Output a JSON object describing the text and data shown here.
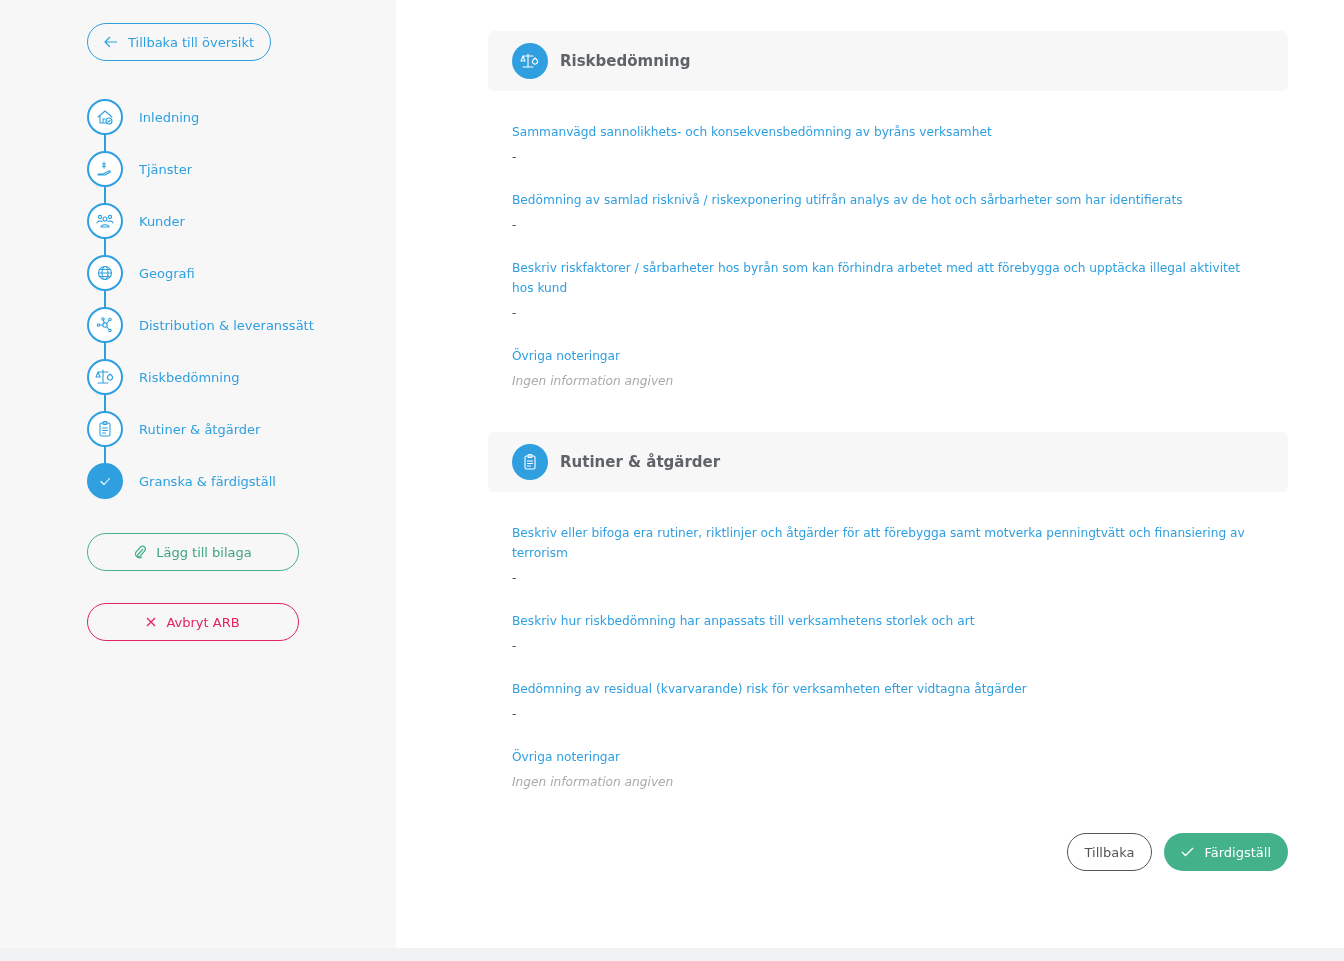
{
  "back_link": {
    "label": "Tillbaka till översikt"
  },
  "steps": [
    {
      "label": "Inledning",
      "kind": "house",
      "selected": false
    },
    {
      "label": "Tjänster",
      "kind": "hand",
      "selected": false
    },
    {
      "label": "Kunder",
      "kind": "people",
      "selected": false
    },
    {
      "label": "Geografi",
      "kind": "globe",
      "selected": false
    },
    {
      "label": "Distribution & leveranssätt",
      "kind": "network",
      "selected": false
    },
    {
      "label": "Riskbedömning",
      "kind": "scale",
      "selected": false
    },
    {
      "label": "Rutiner & åtgärder",
      "kind": "clipboard",
      "selected": false
    },
    {
      "label": "Granska & färdigställ",
      "kind": "check",
      "selected": true
    }
  ],
  "attach_button": {
    "label": "Lägg till bilaga"
  },
  "cancel_button": {
    "label": "Avbryt ARB"
  },
  "sections": [
    {
      "title": "Riskbedömning",
      "kind": "scale",
      "fields": [
        {
          "label": "Sammanvägd sannolikhets- och konsekvensbedömning av byråns verksamhet",
          "value": "-",
          "empty": false
        },
        {
          "label": "Bedömning av samlad risknivå / riskexponering utifrån analys av de hot och sårbarheter som har identifierats",
          "value": "-",
          "empty": false
        },
        {
          "label": "Beskriv riskfaktorer / sårbarheter hos byrån som kan förhindra arbetet med att förebygga och upptäcka illegal aktivitet hos kund",
          "value": "-",
          "empty": false
        },
        {
          "label": "Övriga noteringar",
          "value": "Ingen information angiven",
          "empty": true
        }
      ]
    },
    {
      "title": "Rutiner & åtgärder",
      "kind": "clipboard",
      "fields": [
        {
          "label": "Beskriv eller bifoga era rutiner, riktlinjer och åtgärder för att förebygga samt motverka penningtvätt och finansiering av terrorism",
          "value": "-",
          "empty": false
        },
        {
          "label": "Beskriv hur riskbedömning har anpassats till verksamhetens storlek och art",
          "value": "-",
          "empty": false
        },
        {
          "label": "Bedömning av residual (kvarvarande) risk för verksamheten efter vidtagna åtgärder",
          "value": "-",
          "empty": false
        },
        {
          "label": "Övriga noteringar",
          "value": "Ingen information angiven",
          "empty": true
        }
      ]
    }
  ],
  "footer": {
    "back_button": "Tillbaka",
    "finish_button": "Färdigställ"
  }
}
